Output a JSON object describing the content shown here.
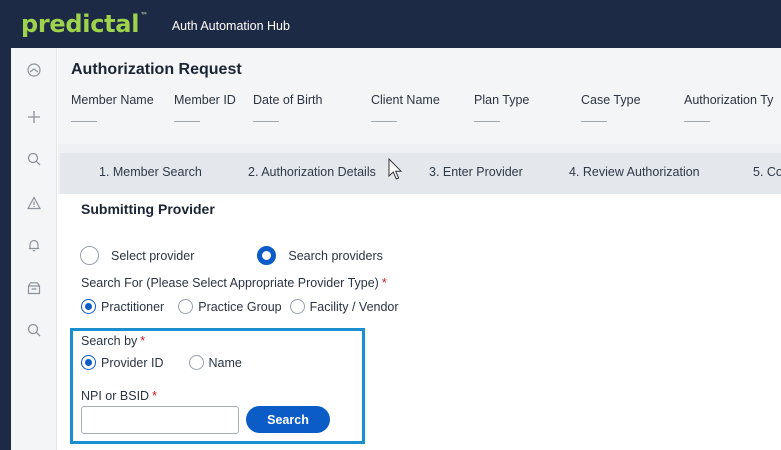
{
  "brand": {
    "logo": "predictal",
    "tm": "™",
    "app_title": "Auth Automation Hub"
  },
  "sidebar": {
    "icons": [
      "dashboard-icon",
      "plus-icon",
      "search-icon",
      "warning-icon",
      "bell-icon",
      "inbox-icon",
      "search-icon"
    ]
  },
  "request": {
    "title": "Authorization Request",
    "columns": [
      {
        "label": "Member Name"
      },
      {
        "label": "Member ID"
      },
      {
        "label": "Date of Birth"
      },
      {
        "label": "Client Name"
      },
      {
        "label": "Plan Type"
      },
      {
        "label": "Case Type"
      },
      {
        "label": "Authorization Ty"
      }
    ]
  },
  "steps": [
    "1. Member Search",
    "2. Authorization Details",
    "3. Enter Provider",
    "4. Review Authorization",
    "5. Co"
  ],
  "provider": {
    "section_title": "Submitting Provider",
    "mode_options": [
      {
        "label": "Select provider",
        "selected": false
      },
      {
        "label": "Search providers",
        "selected": true
      }
    ],
    "search_for_label": "Search For (Please Select Appropriate Provider Type)",
    "required_mark": "*",
    "type_options": [
      {
        "label": "Practitioner",
        "selected": true
      },
      {
        "label": "Practice Group",
        "selected": false
      },
      {
        "label": "Facility / Vendor",
        "selected": false
      }
    ],
    "search_by_label": "Search by",
    "search_by_options": [
      {
        "label": "Provider ID",
        "selected": true
      },
      {
        "label": "Name",
        "selected": false
      }
    ],
    "npi_label": "NPI or BSID",
    "npi_value": "",
    "search_button": "Search"
  },
  "colors": {
    "nav_bg": "#1d2a45",
    "logo": "#9fd34c",
    "accent": "#0b5cc7",
    "highlight": "#1a8fd0",
    "required": "#d0162b"
  }
}
